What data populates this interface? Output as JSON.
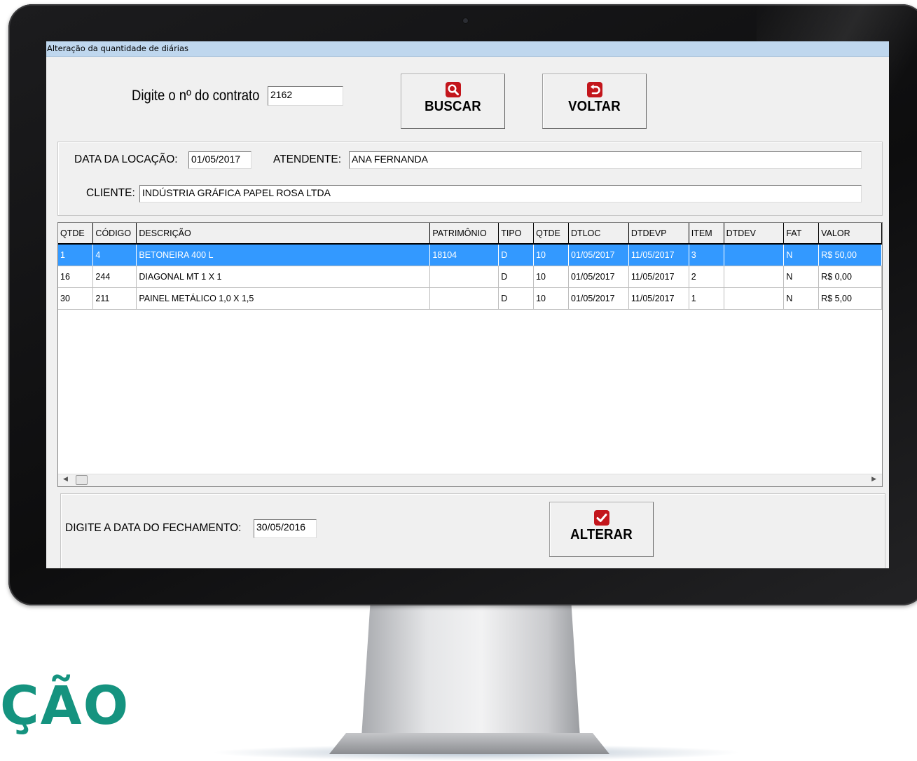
{
  "window": {
    "title": "Alteração da quantidade de diárias"
  },
  "search": {
    "label": "Digite o nº do contrato",
    "contract_value": "2162",
    "buscar_label": "BUSCAR",
    "buscar_icon": "search-icon",
    "voltar_label": "VOLTAR",
    "voltar_icon": "back-arrow-icon"
  },
  "info": {
    "data_locacao_label": "DATA DA LOCAÇÃO:",
    "data_locacao_value": "01/05/2017",
    "atendente_label": "ATENDENTE:",
    "atendente_value": "ANA FERNANDA",
    "cliente_label": "CLIENTE:",
    "cliente_value": "INDÚSTRIA GRÁFICA PAPEL ROSA LTDA"
  },
  "table": {
    "columns": [
      "QTDE",
      "CÓDIGO",
      "DESCRIÇÃO",
      "PATRIMÔNIO",
      "TIPO",
      "QTDE",
      "DTLOC",
      "DTDEVP",
      "ITEM",
      "DTDEV",
      "FAT",
      "VALOR"
    ],
    "rows": [
      [
        "1",
        "4",
        "BETONEIRA 400 L",
        "18104",
        "D",
        "10",
        "01/05/2017",
        "11/05/2017",
        "3",
        "",
        "N",
        "R$ 50,00"
      ],
      [
        "16",
        "244",
        "DIAGONAL MT 1 X 1",
        "",
        "D",
        "10",
        "01/05/2017",
        "11/05/2017",
        "2",
        "",
        "N",
        "R$ 0,00"
      ],
      [
        "30",
        "211",
        "PAINEL METÁLICO 1,0 X 1,5",
        "",
        "D",
        "10",
        "01/05/2017",
        "11/05/2017",
        "1",
        "",
        "N",
        "R$ 5,00"
      ]
    ],
    "selected_row": 0
  },
  "footer": {
    "fechamento_label": "DIGITE A DATA DO FECHAMENTO:",
    "fechamento_value": "30/05/2016",
    "alterar_label": "ALTERAR",
    "alterar_icon": "checkbox-check-icon"
  },
  "watermark": {
    "text": "ÇÃO"
  },
  "colors": {
    "accent_red": "#c3161c",
    "selection_blue": "#3399ff",
    "titlebar": "#bfd7ee",
    "watermark_green": "#15937f"
  }
}
